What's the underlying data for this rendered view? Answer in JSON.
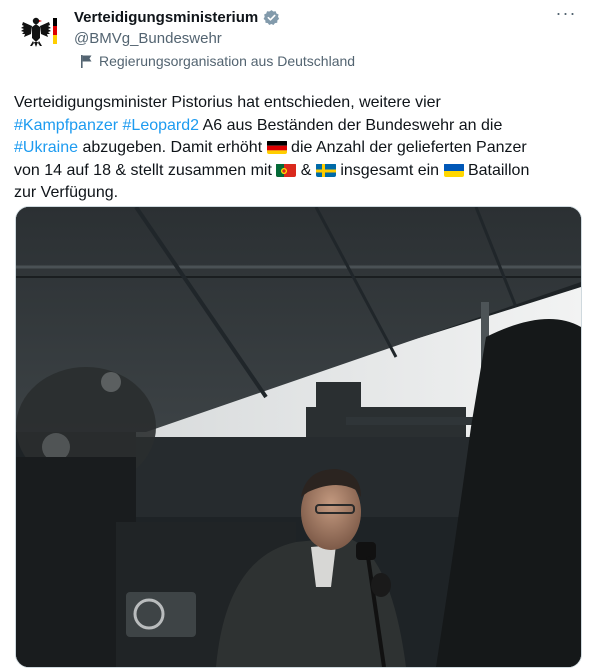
{
  "account": {
    "name": "Verteidigungsministerium",
    "handle": "@BMVg_Bundeswehr",
    "label": "Regierungsorganisation aus Deutschland"
  },
  "post": {
    "line1": "Verteidigungsminister Pistorius hat entschieden, weitere vier",
    "tag_kampfpanzer": "#Kampfpanzer",
    "tag_leopard": "#Leopard2",
    "line2_rest": " A6 aus Beständen der Bundeswehr an die",
    "tag_ukraine": "#Ukraine",
    "line3_a": " abzugeben. Damit erhöht ",
    "line3_b": " die Anzahl der gelieferten Panzer",
    "line4_a": "von 14 auf 18 & stellt zusammen mit ",
    "line4_b": " & ",
    "line4_c": " insgesamt ein ",
    "line4_d": " Bataillon",
    "line5": "zur Verfügung."
  },
  "icons": {
    "more": "more-icon",
    "verified": "verified-badge-icon",
    "flag": "flag-icon",
    "eagle": "federal-eagle-icon"
  },
  "colors": {
    "link": "#1d9bf0",
    "verified_gray": "#829aab",
    "muted": "#536471"
  }
}
